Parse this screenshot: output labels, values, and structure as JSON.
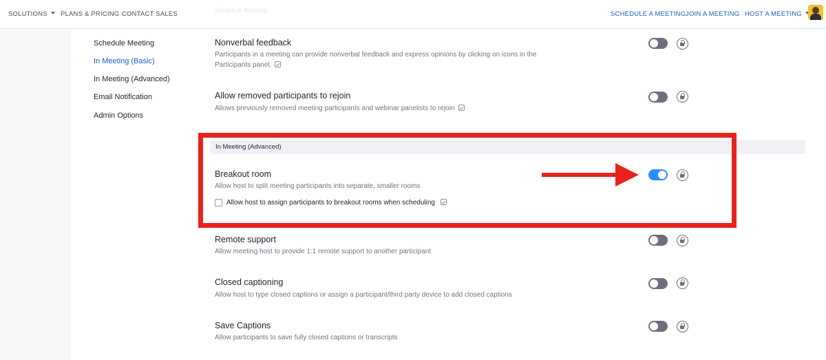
{
  "nav": {
    "left": [
      {
        "label": "SOLUTIONS",
        "caret": true
      },
      {
        "label": "PLANS & PRICING"
      },
      {
        "label": "CONTACT SALES"
      }
    ],
    "right": [
      {
        "label": "SCHEDULE A MEETING"
      },
      {
        "label": "JOIN A MEETING"
      },
      {
        "label": "HOST A MEETING",
        "caret": true
      }
    ]
  },
  "sidebar": {
    "items": [
      {
        "label": "Schedule Meeting"
      },
      {
        "label": "In Meeting (Basic)",
        "active": true
      },
      {
        "label": "In Meeting (Advanced)"
      },
      {
        "label": "Email Notification"
      },
      {
        "label": "Admin Options"
      }
    ]
  },
  "settings": {
    "faded_header": "Schedule Meeting",
    "nonverbal": {
      "title": "Nonverbal feedback",
      "desc_line1": "Participants in a meeting can provide nonverbal feedback and express opinions by clicking on icons in the",
      "desc_line2": "Participants panel.",
      "enabled": false
    },
    "rejoin": {
      "title": "Allow removed participants to rejoin",
      "desc": "Allows previously removed meeting participants and webinar panelists to rejoin",
      "enabled": false
    },
    "section_header": "In Meeting (Advanced)",
    "breakout": {
      "title": "Breakout room",
      "desc": "Allow host to split meeting participants into separate, smaller rooms",
      "checkbox_label": "Allow host to assign participants to breakout rooms when scheduling",
      "checkbox_checked": false,
      "enabled": true
    },
    "remote": {
      "title": "Remote support",
      "desc": "Allow meeting host to provide 1:1 remote support to another participant",
      "enabled": false
    },
    "captioning": {
      "title": "Closed captioning",
      "desc": "Allow host to type closed captions or assign a participant/third party device to add closed captions",
      "enabled": false
    },
    "save_captions": {
      "title": "Save Captions",
      "desc": "Allow participants to save fully closed captions or transcripts",
      "enabled": false
    }
  },
  "colors": {
    "accent": "#2d8cff",
    "link": "#1f5bc6",
    "annotation": "#e8231d",
    "toggle_off": "#6e6f7d"
  }
}
